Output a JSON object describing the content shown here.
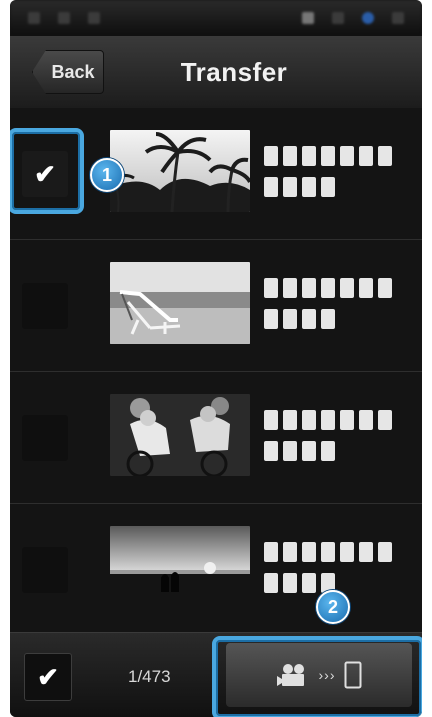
{
  "header": {
    "back_label": "Back",
    "title": "Transfer"
  },
  "rows": [
    {
      "selected": true,
      "thumbnail": "palm-trees-photo"
    },
    {
      "selected": false,
      "thumbnail": "beach-chair-photo"
    },
    {
      "selected": false,
      "thumbnail": "cyclists-photo"
    },
    {
      "selected": false,
      "thumbnail": "sunset-couple-photo"
    }
  ],
  "callouts": {
    "first": "1",
    "second": "2"
  },
  "footer": {
    "count": "1/473"
  },
  "colors": {
    "highlight": "#4aa8e0",
    "background": "#151515"
  }
}
